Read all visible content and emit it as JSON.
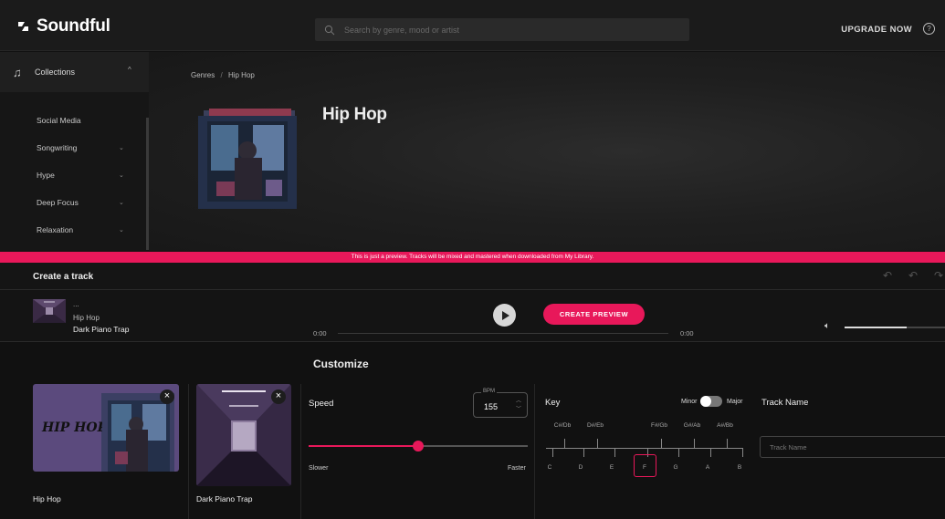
{
  "app": {
    "name": "Soundful"
  },
  "header": {
    "search_placeholder": "Search by genre, mood or artist",
    "upgrade_label": "UPGRADE NOW",
    "help_glyph": "?"
  },
  "sidebar": {
    "section_label": "Collections",
    "items": [
      {
        "label": "Social Media",
        "expandable": false
      },
      {
        "label": "Songwriting",
        "expandable": true
      },
      {
        "label": "Hype",
        "expandable": true
      },
      {
        "label": "Deep Focus",
        "expandable": true
      },
      {
        "label": "Relaxation",
        "expandable": true
      }
    ]
  },
  "hero": {
    "breadcrumb": [
      "Genres",
      "Hip Hop"
    ],
    "breadcrumb_separator": "/",
    "title": "Hip Hop"
  },
  "banner": {
    "text": "This is just a preview. Tracks will be mixed and mastered when downloaded from My Library."
  },
  "create": {
    "title": "Create a track"
  },
  "player": {
    "menu_dots": "...",
    "genre": "Hip Hop",
    "track": "Dark Piano Trap",
    "time_start": "0:00",
    "time_end": "0:00",
    "progress": 0,
    "volume": 0.62,
    "create_preview_label": "CREATE PREVIEW"
  },
  "cards": [
    {
      "label": "Hip Hop",
      "art_text": "HIP HOP"
    },
    {
      "label": "Dark Piano Trap"
    }
  ],
  "customize": {
    "title": "Customize",
    "speed": {
      "label": "Speed",
      "bpm_label": "BPM",
      "bpm_value": "155",
      "slider_value": 0.5,
      "slower_label": "Slower",
      "faster_label": "Faster"
    },
    "key": {
      "label": "Key",
      "minor_label": "Minor",
      "major_label": "Major",
      "sharps": [
        "C#/Db",
        "D#/Eb",
        "F#/Gb",
        "G#/Ab",
        "A#/Bb"
      ],
      "naturals": [
        "C",
        "D",
        "E",
        "F",
        "G",
        "A",
        "B"
      ],
      "selected": "F"
    },
    "track_name": {
      "label": "Track Name",
      "placeholder": "Track Name",
      "value": ""
    }
  },
  "colors": {
    "accent": "#e8185a",
    "background": "#111111"
  }
}
